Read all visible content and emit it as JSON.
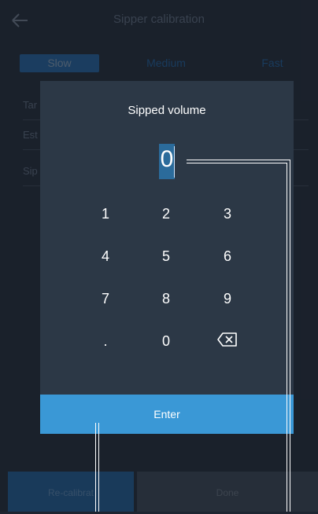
{
  "header": {
    "title": "Sipper calibration"
  },
  "speed": {
    "options": [
      "Slow",
      "Medium",
      "Fast"
    ],
    "selected": "Slow"
  },
  "rows": [
    "Tar",
    "Est",
    "Sip"
  ],
  "dialog": {
    "title": "Sipped volume",
    "value": "0",
    "keys": [
      "1",
      "2",
      "3",
      "4",
      "5",
      "6",
      "7",
      "8",
      "9",
      ".",
      "0"
    ],
    "backspace_icon": "backspace-icon",
    "enter_label": "Enter"
  },
  "footer": {
    "recalibrate_label": "Re-calibrat",
    "done_label": "Done"
  },
  "colors": {
    "accent": "#3a98d6",
    "selection": "#2b6b9b",
    "background": "#1e2531"
  }
}
